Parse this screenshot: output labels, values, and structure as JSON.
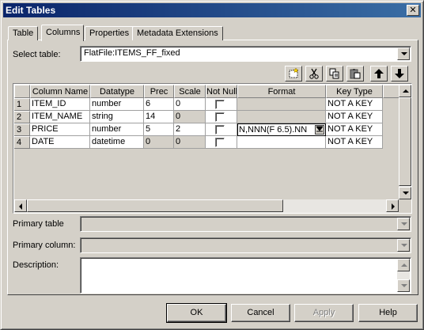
{
  "window": {
    "title": "Edit Tables",
    "close_glyph": "✕"
  },
  "tabs": [
    {
      "label": "Table"
    },
    {
      "label": "Columns"
    },
    {
      "label": "Properties"
    },
    {
      "label": "Metadata Extensions"
    }
  ],
  "active_tab": "Columns",
  "select_table": {
    "label": "Select table:",
    "value": "FlatFile:ITEMS_FF_fixed"
  },
  "toolbar": {
    "new_icon": "new-column-icon",
    "cut_icon": "cut-icon",
    "copy_icon": "copy-icon",
    "paste_icon": "paste-icon",
    "up_icon": "move-up-icon",
    "down_icon": "move-down-icon"
  },
  "grid": {
    "headers": [
      "Column Name",
      "Datatype",
      "Prec",
      "Scale",
      "Not Null",
      "Format",
      "Key Type"
    ],
    "rows": [
      {
        "num": "1",
        "name": "ITEM_ID",
        "datatype": "number",
        "prec": "6",
        "scale": "0",
        "not_null": false,
        "format": "",
        "key_type": "NOT A KEY"
      },
      {
        "num": "2",
        "name": "ITEM_NAME",
        "datatype": "string",
        "prec": "14",
        "scale": "0",
        "not_null": false,
        "format": "",
        "key_type": "NOT A KEY"
      },
      {
        "num": "3",
        "name": "PRICE",
        "datatype": "number",
        "prec": "5",
        "scale": "2",
        "not_null": false,
        "format": "N,NNN(F 6.5).NN",
        "key_type": "NOT A KEY"
      },
      {
        "num": "4",
        "name": "DATE",
        "datatype": "datetime",
        "prec": "0",
        "scale": "0",
        "not_null": false,
        "format": "",
        "key_type": "NOT A KEY"
      }
    ]
  },
  "primary_table": {
    "label": "Primary table",
    "value": ""
  },
  "primary_column": {
    "label": "Primary column:",
    "value": ""
  },
  "description": {
    "label": "Description:",
    "value": ""
  },
  "buttons": {
    "ok": "OK",
    "cancel": "Cancel",
    "apply": "Apply",
    "help": "Help"
  }
}
